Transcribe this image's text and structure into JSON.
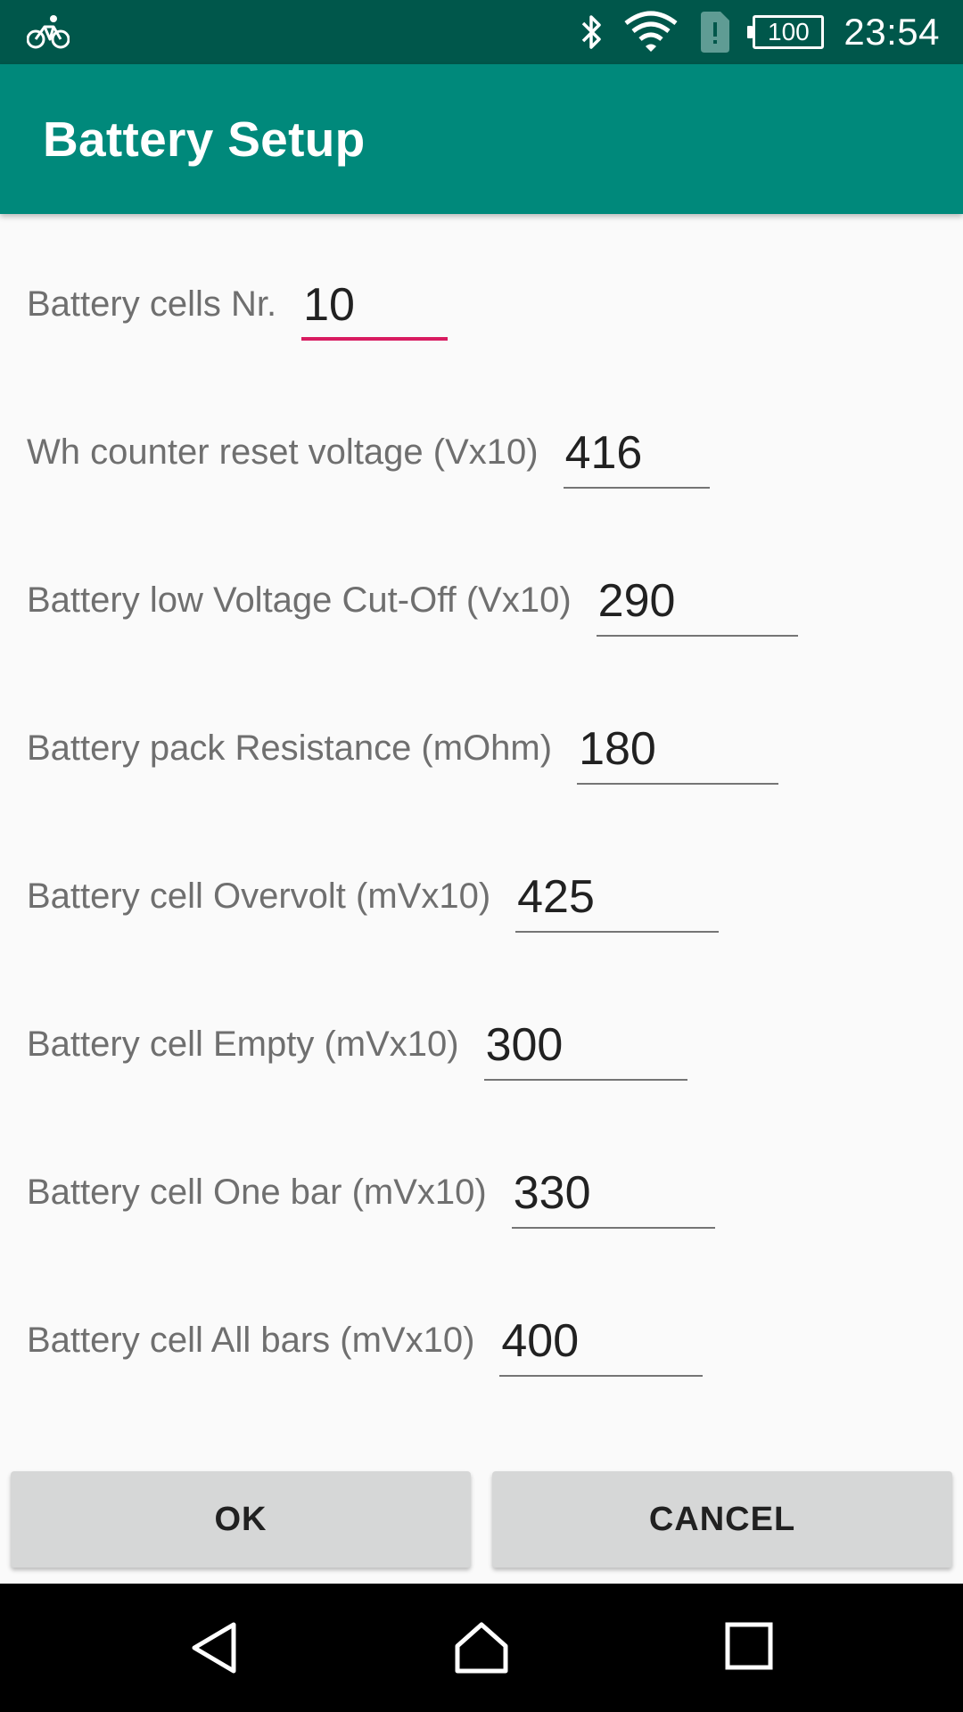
{
  "status_bar": {
    "time": "23:54",
    "battery_level": "100",
    "icons": [
      "bicycle-icon",
      "bluetooth-icon",
      "wifi-icon",
      "sim-alert-icon",
      "battery-icon"
    ]
  },
  "app_bar": {
    "title": "Battery Setup"
  },
  "fields": [
    {
      "label": "Battery cells Nr.",
      "value": "10"
    },
    {
      "label": "Wh counter reset voltage (Vx10)",
      "value": "416"
    },
    {
      "label": "Battery low Voltage Cut-Off (Vx10)",
      "value": "290"
    },
    {
      "label": "Battery pack Resistance (mOhm)",
      "value": "180"
    },
    {
      "label": "Battery cell Overvolt (mVx10)",
      "value": "425"
    },
    {
      "label": "Battery cell Empty (mVx10)",
      "value": "300"
    },
    {
      "label": "Battery cell One bar (mVx10)",
      "value": "330"
    },
    {
      "label": "Battery cell All bars (mVx10)",
      "value": "400"
    }
  ],
  "buttons": {
    "ok": "OK",
    "cancel": "CANCEL"
  },
  "nav_bar": {
    "icons": [
      "back-icon",
      "home-icon",
      "recents-icon"
    ]
  },
  "colors": {
    "status_bar": "#00574b",
    "app_bar": "#00897b",
    "focus_accent": "#d81b60"
  }
}
